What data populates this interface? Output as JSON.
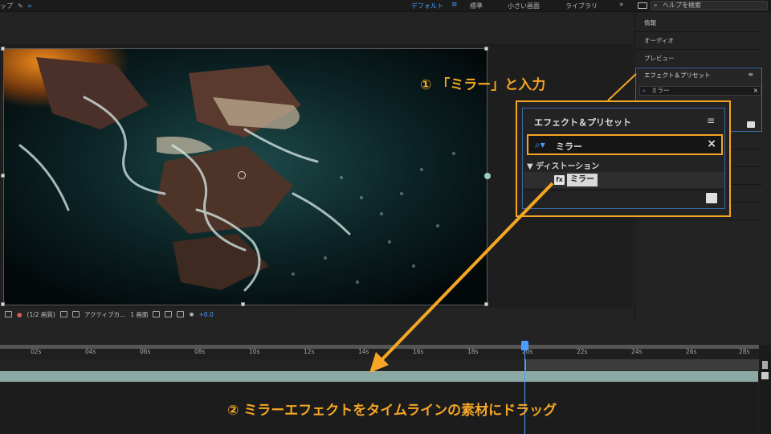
{
  "topbar": {
    "workspaces": [
      "デフォルト",
      "標準",
      "小さい画面",
      "ライブラリ"
    ],
    "active_workspace": "デフォルト",
    "more": "»",
    "help_search_placeholder": "ヘルプを検索"
  },
  "viewer": {
    "magnification": "(1/2 画質)",
    "camera": "アクティブカ...",
    "views": "1 画面",
    "exposure": "+0.0"
  },
  "right_panels": {
    "items": [
      "情報",
      "オーディオ",
      "プレビュー"
    ],
    "effects_panel": {
      "title": "エフェクト＆プリセット",
      "search_value": "ミラー"
    }
  },
  "zoom_panel": {
    "title": "エフェクト＆プリセット",
    "search_value": "ミラー",
    "folder": "▼ ディストーション",
    "effect": "ミラー"
  },
  "timeline": {
    "ticks": [
      "02s",
      "04s",
      "06s",
      "08s",
      "10s",
      "12s",
      "14s",
      "16s",
      "18s",
      "20s",
      "22s",
      "24s",
      "26s",
      "28s"
    ]
  },
  "callouts": {
    "step1": "① 「ミラー」と入力",
    "step2": "② ミラーエフェクトをタイムラインの素材にドラッグ"
  },
  "colors": {
    "accent": "#f5a623",
    "highlight_blue": "#4a9cff"
  }
}
